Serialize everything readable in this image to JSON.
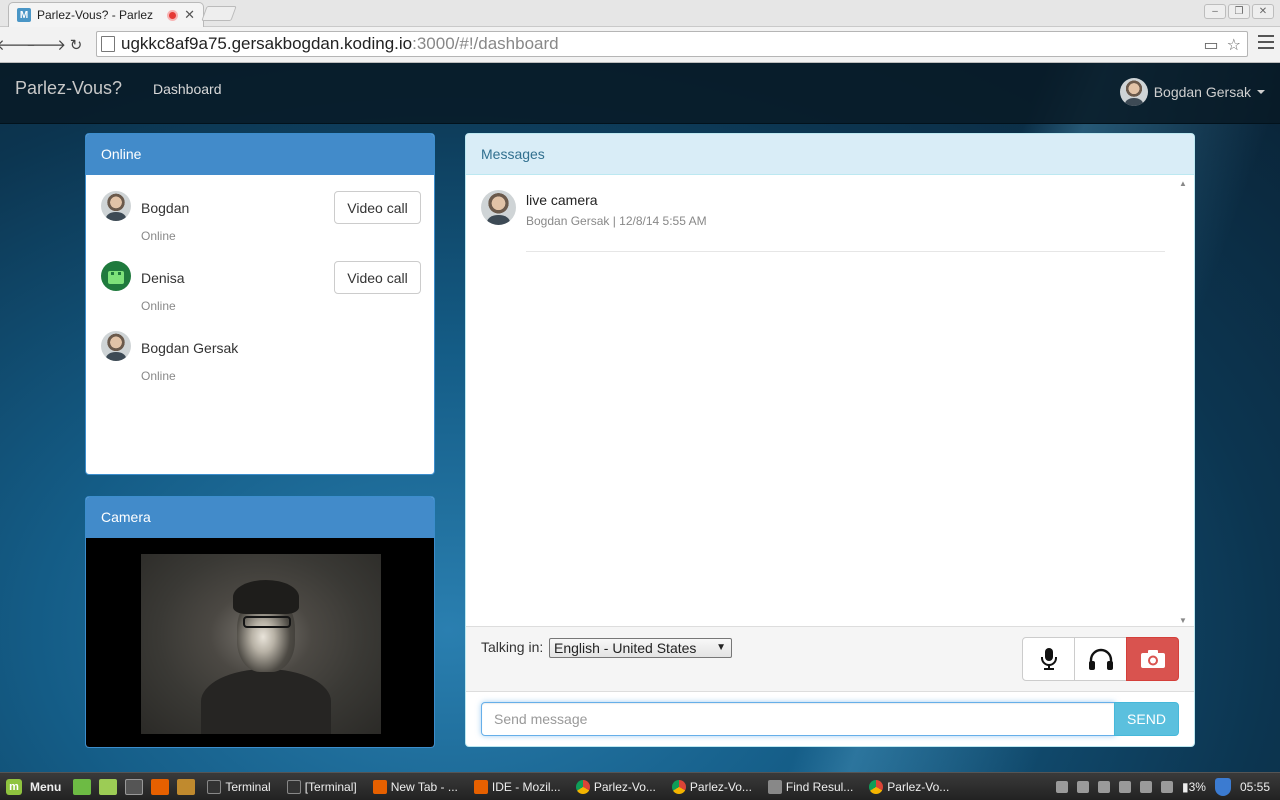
{
  "browser": {
    "tab_title": "Parlez-Vous? - Parlez",
    "favicon_letter": "M",
    "url_host": "ugkkc8af9a75.gersakbogdan.koding.io",
    "url_rest": ":3000/#!/dashboard"
  },
  "navbar": {
    "brand": "Parlez-Vous?",
    "dashboard_link": "Dashboard",
    "user_name": "Bogdan Gersak"
  },
  "online_panel": {
    "title": "Online",
    "users": [
      {
        "name": "Bogdan",
        "status": "Online",
        "action": "Video call",
        "avatar": "photo"
      },
      {
        "name": "Denisa",
        "status": "Online",
        "action": "Video call",
        "avatar": "space-invader"
      },
      {
        "name": "Bogdan Gersak",
        "status": "Online",
        "avatar": "photo"
      }
    ]
  },
  "camera_panel": {
    "title": "Camera"
  },
  "messages_panel": {
    "title": "Messages",
    "messages": [
      {
        "text": "live camera",
        "meta": "Bogdan Gersak | 12/8/14 5:55 AM"
      }
    ],
    "talking_label": "Talking in:",
    "language": "English - United States",
    "buttons": [
      "microphone-icon",
      "headphones-icon",
      "camera-icon"
    ],
    "input_placeholder": "Send message",
    "send_label": "SEND"
  },
  "taskbar": {
    "menu_label": "Menu",
    "tasks": [
      {
        "label": "Terminal",
        "color": "#333333"
      },
      {
        "label": "[Terminal]",
        "color": "#333333"
      },
      {
        "label": "New Tab - ...",
        "color": "#e66000"
      },
      {
        "label": "IDE - Mozil...",
        "color": "#e66000"
      },
      {
        "label": "Parlez-Vo...",
        "color": "#4285f4"
      },
      {
        "label": "Parlez-Vo...",
        "color": "#4285f4"
      },
      {
        "label": "Find Resul...",
        "color": "#888888"
      },
      {
        "label": "Parlez-Vo...",
        "color": "#4285f4"
      }
    ],
    "battery": "3%",
    "clock": "05:55"
  },
  "colors": {
    "primary": "#428bca",
    "info_bg": "#d9edf7",
    "danger": "#d9534f",
    "send": "#5bc0de"
  }
}
